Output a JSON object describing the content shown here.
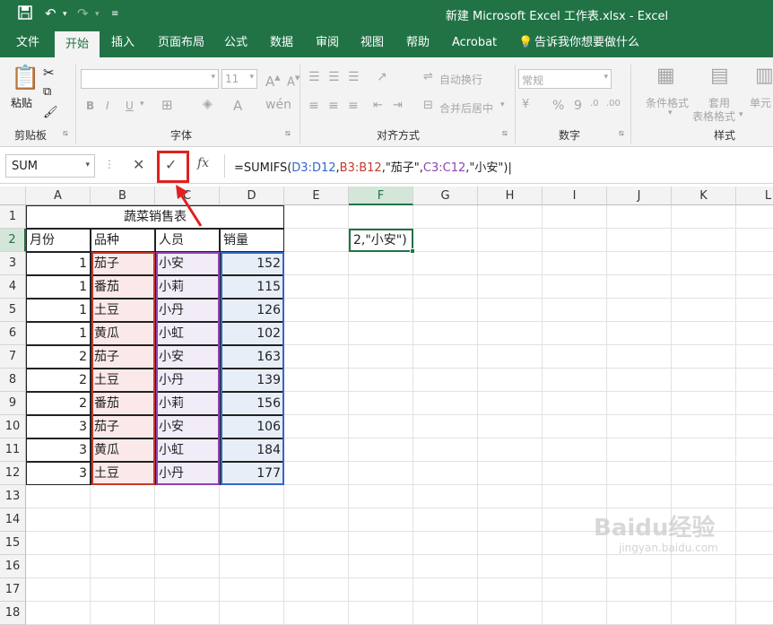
{
  "window": {
    "title": "新建 Microsoft Excel 工作表.xlsx  -  Excel"
  },
  "ribbon_tabs": [
    "文件",
    "开始",
    "插入",
    "页面布局",
    "公式",
    "数据",
    "审阅",
    "视图",
    "帮助",
    "Acrobat",
    "告诉我你想要做什么"
  ],
  "ribbon": {
    "clipboard": {
      "paste": "粘贴",
      "label": "剪贴板"
    },
    "font": {
      "size": "11",
      "bold": "B",
      "italic": "I",
      "underline": "U",
      "label": "字体"
    },
    "align": {
      "wrap": "自动换行",
      "merge": "合并后居中",
      "label": "对齐方式"
    },
    "number": {
      "format": "常规",
      "percent": "%",
      "comma": "9",
      "label": "数字"
    },
    "styles": {
      "conditional": "条件格式",
      "table1": "套用",
      "table2": "表格格式",
      "cell": "单元",
      "label": "样式"
    }
  },
  "formula_bar": {
    "name_box": "SUM",
    "formula_parts": [
      {
        "text": "=SUMIFS(",
        "color": "#222222"
      },
      {
        "text": "D3:D12",
        "color": "#3366cc"
      },
      {
        "text": ",",
        "color": "#222222"
      },
      {
        "text": "B3:B12",
        "color": "#c0392b"
      },
      {
        "text": ",\"茄子\",",
        "color": "#222222"
      },
      {
        "text": "C3:C12",
        "color": "#8e44ad"
      },
      {
        "text": ",\"小安\")",
        "color": "#222222"
      }
    ]
  },
  "columns": [
    "A",
    "B",
    "C",
    "D",
    "E",
    "F",
    "G",
    "H",
    "I",
    "J",
    "K",
    "L"
  ],
  "rows": [
    "1",
    "2",
    "3",
    "4",
    "5",
    "6",
    "7",
    "8",
    "9",
    "10",
    "11",
    "12",
    "13",
    "14",
    "15",
    "16",
    "17",
    "18"
  ],
  "table": {
    "title": "蔬菜销售表",
    "headers": [
      "月份",
      "品种",
      "人员",
      "销量"
    ],
    "data": [
      [
        "1",
        "茄子",
        "小安",
        "152"
      ],
      [
        "1",
        "番茄",
        "小莉",
        "115"
      ],
      [
        "1",
        "土豆",
        "小丹",
        "126"
      ],
      [
        "1",
        "黄瓜",
        "小虹",
        "102"
      ],
      [
        "2",
        "茄子",
        "小安",
        "163"
      ],
      [
        "2",
        "土豆",
        "小丹",
        "139"
      ],
      [
        "2",
        "番茄",
        "小莉",
        "156"
      ],
      [
        "3",
        "茄子",
        "小安",
        "106"
      ],
      [
        "3",
        "黄瓜",
        "小虹",
        "184"
      ],
      [
        "3",
        "土豆",
        "小丹",
        "177"
      ]
    ]
  },
  "active_cell": {
    "ref": "F2",
    "display": "2,\"小安\")"
  },
  "watermark": {
    "main": "Baidu经验",
    "sub": "jingyan.baidu.com"
  }
}
